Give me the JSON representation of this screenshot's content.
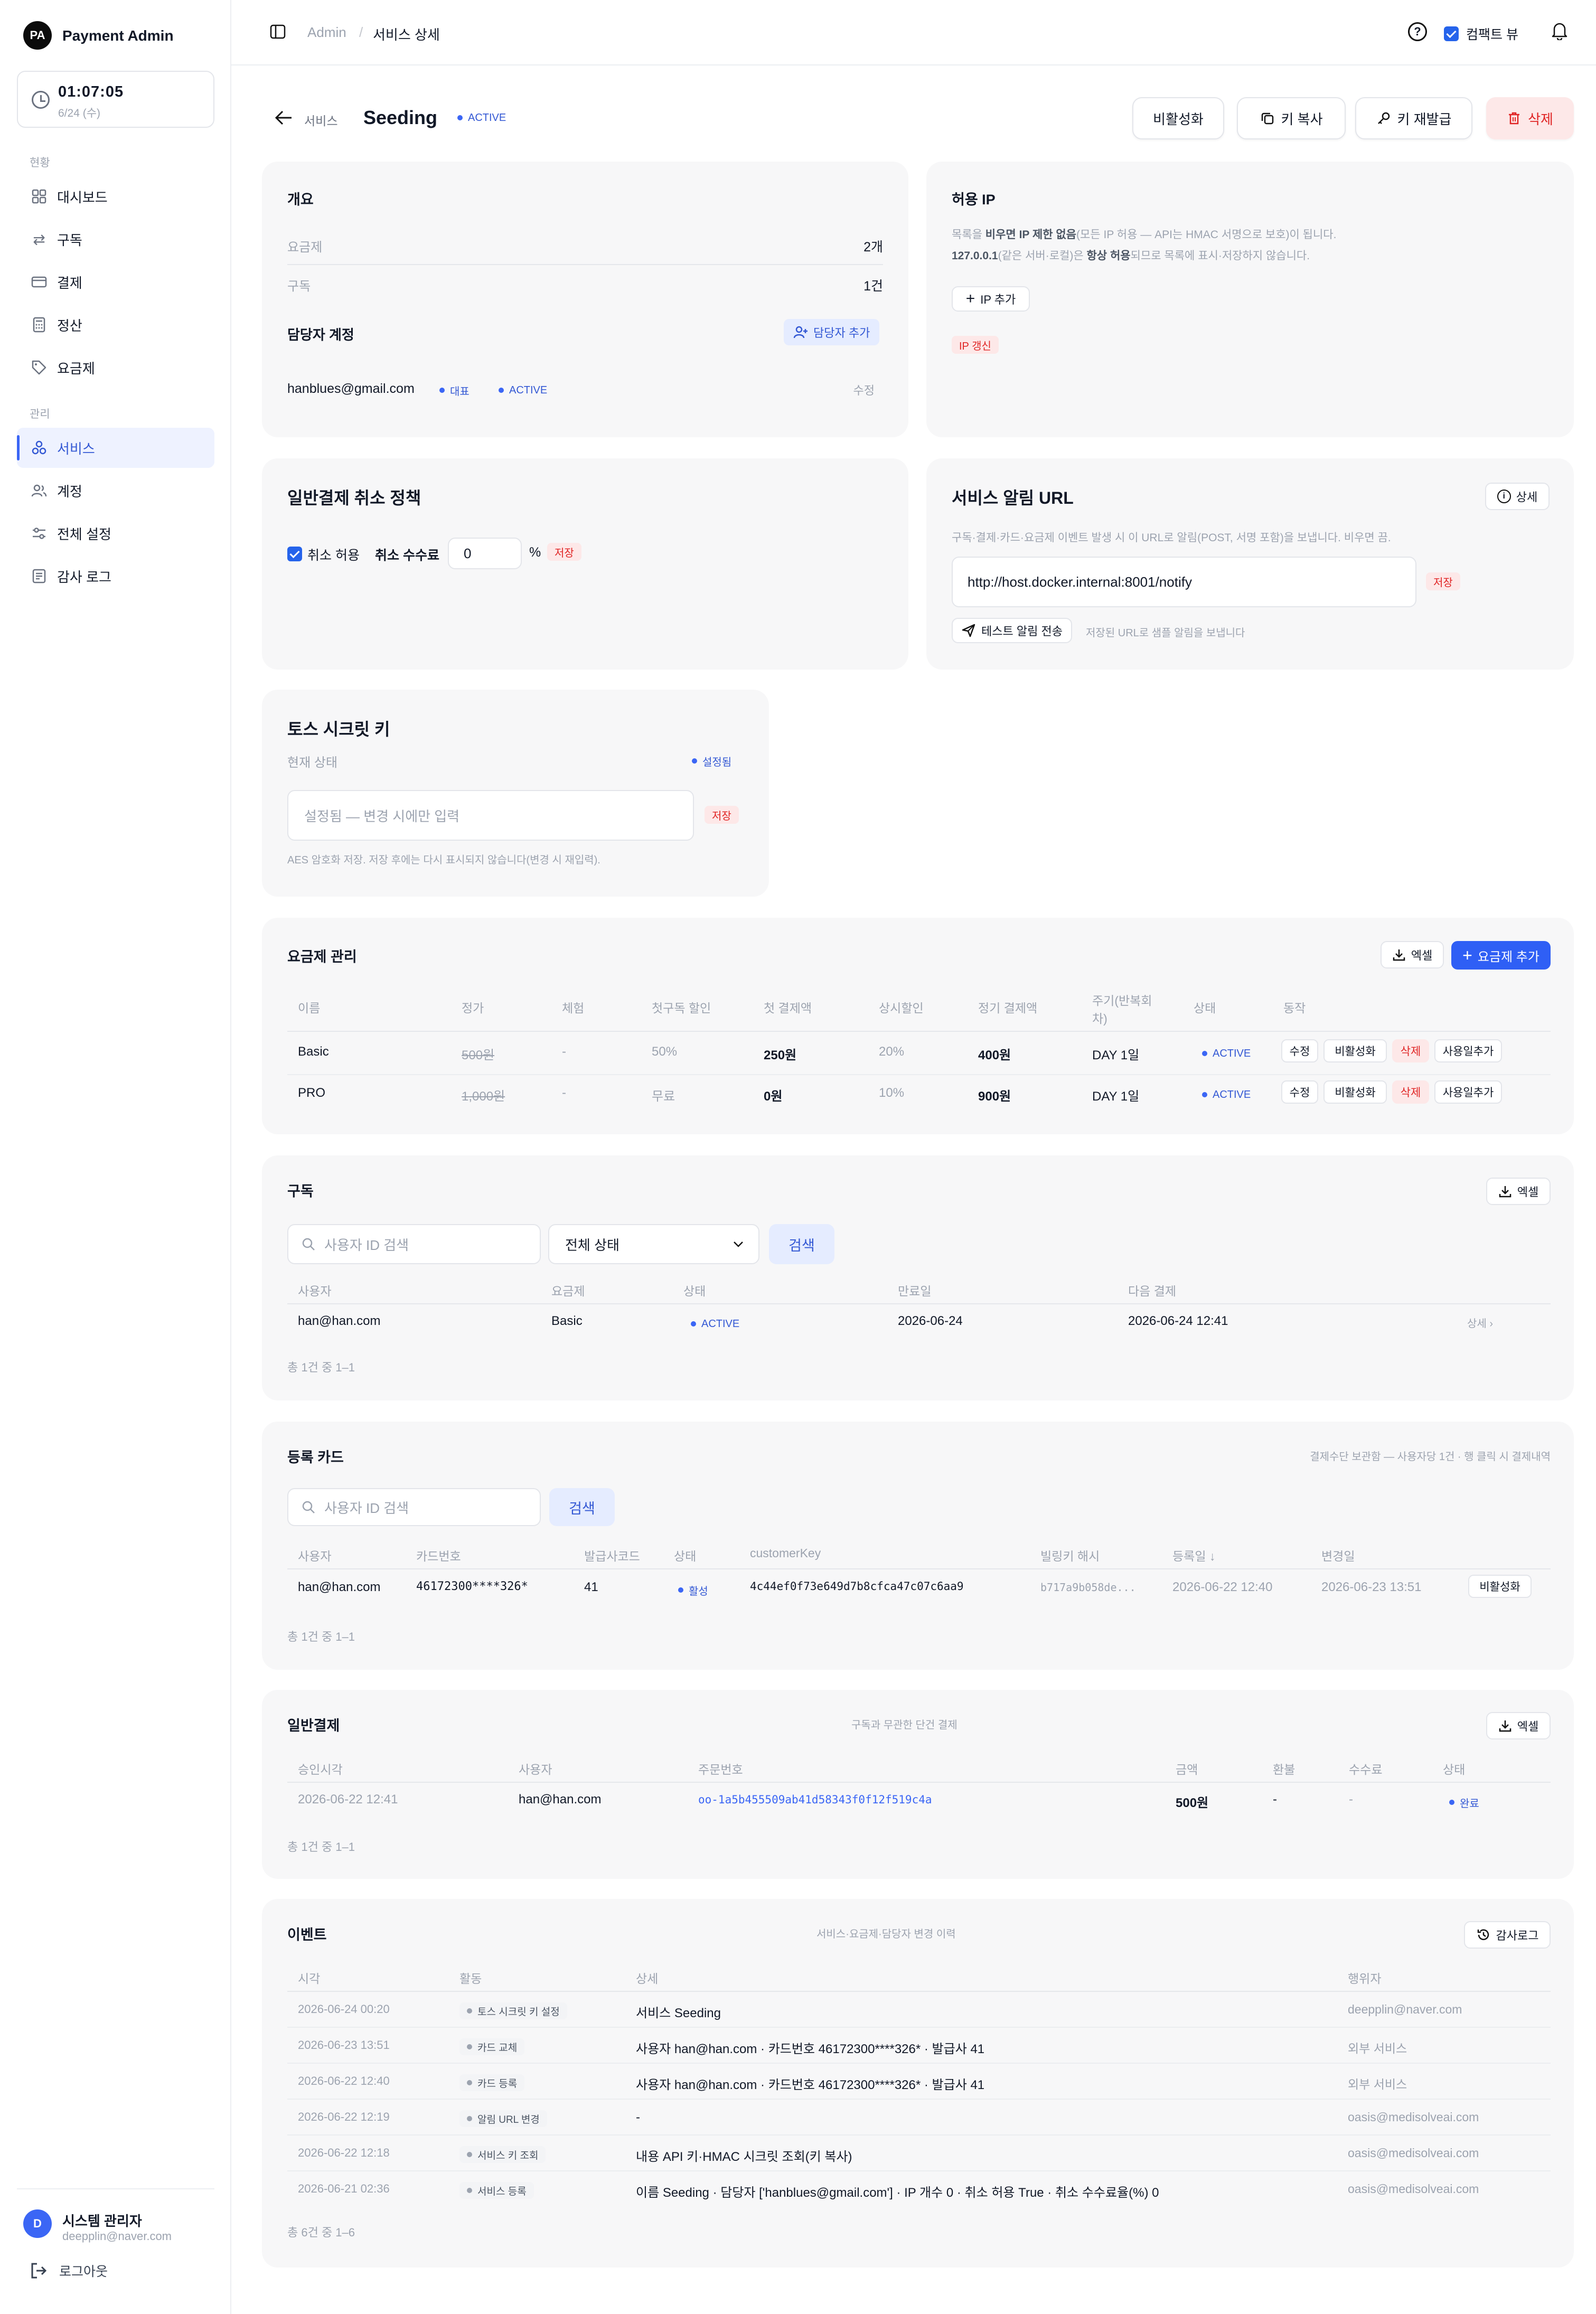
{
  "sidebar": {
    "logo": "PA",
    "brand": "Payment Admin",
    "clock_time": "01:07:05",
    "clock_date": "6/24 (수)",
    "section_status": "현황",
    "section_manage": "관리",
    "items": [
      {
        "label": "대시보드",
        "icon": "dashboard-icon"
      },
      {
        "label": "구독",
        "icon": "repeat-icon"
      },
      {
        "label": "결제",
        "icon": "card-icon"
      },
      {
        "label": "정산",
        "icon": "calculator-icon"
      },
      {
        "label": "요금제",
        "icon": "tag-icon"
      },
      {
        "label": "서비스",
        "icon": "services-icon"
      },
      {
        "label": "계정",
        "icon": "users-icon"
      },
      {
        "label": "전체 설정",
        "icon": "settings-icon"
      },
      {
        "label": "감사 로그",
        "icon": "log-icon"
      }
    ],
    "user_initial": "D",
    "user_name": "시스템 관리자",
    "user_email": "deepplin@naver.com",
    "logout": "로그아웃"
  },
  "topbar": {
    "breadcrumb_root": "Admin",
    "breadcrumb_sep": "/",
    "breadcrumb_current": "서비스 상세",
    "compact_label": "컴팩트 뷰"
  },
  "header": {
    "back_label": "서비스",
    "title": "Seeding",
    "status": "ACTIVE",
    "btn_deactivate": "비활성화",
    "btn_copy_key": "키 복사",
    "btn_reissue_key": "키 재발급",
    "btn_delete": "삭제"
  },
  "overview": {
    "title": "개요",
    "plans_label": "요금제",
    "plans_value": "2개",
    "subs_label": "구독",
    "subs_value": "1건",
    "managers_title": "담당자 계정",
    "add_manager": "담당자 추가",
    "manager_email": "hanblues@gmail.com",
    "manager_badge_rep": "대표",
    "manager_badge_status": "ACTIVE",
    "manager_edit": "수정"
  },
  "allowed_ip": {
    "title": "허용 IP",
    "desc1_a": "목록을 ",
    "desc1_b": "비우면 IP 제한 없음",
    "desc1_c": "(모든 IP 허용 — API는 HMAC 서명으로 보호)이 됩니다.",
    "desc2_a": "127.0.0.1",
    "desc2_b": "(같은 서버·로컬)은 ",
    "desc2_c": "항상 허용",
    "desc2_d": "되므로 목록에 표시·저장하지 않습니다.",
    "add_ip": "IP 추가",
    "refresh_ip": "IP 갱신"
  },
  "cancel_policy": {
    "title": "일반결제 취소 정책",
    "allow_cancel": "취소 허용",
    "fee_label": "취소 수수료",
    "fee_value": "0",
    "fee_unit": "%",
    "save": "저장"
  },
  "notify_url": {
    "title": "서비스 알림 URL",
    "detail": "상세",
    "desc": "구독·결제·카드·요금제 이벤트 발생 시 이 URL로 알림(POST, 서명 포함)을 보냅니다. 비우면 끔.",
    "url": "http://host.docker.internal:8001/notify",
    "save": "저장",
    "test_send": "테스트 알림 전송",
    "test_hint": "저장된 URL로 샘플 알림을 보냅니다"
  },
  "toss_key": {
    "title": "토스 시크릿 키",
    "status_label": "현재 상태",
    "status_value": "설정됨",
    "placeholder": "설정됨 — 변경 시에만 입력",
    "save": "저장",
    "hint": "AES 암호화 저장. 저장 후에는 다시 표시되지 않습니다(변경 시 재입력)."
  },
  "plans": {
    "title": "요금제 관리",
    "excel": "엑셀",
    "add": "요금제 추가",
    "headers": [
      "이름",
      "정가",
      "체험",
      "첫구독 할인",
      "첫 결제액",
      "상시할인",
      "정기 결제액",
      "주기(반복회차)",
      "상태",
      "동작"
    ],
    "rows": [
      {
        "name": "Basic",
        "list_price": "500원",
        "trial": "-",
        "first_discount": "50%",
        "first_amount": "250원",
        "always_discount": "20%",
        "regular_amount": "400원",
        "cycle": "DAY 1일",
        "status": "ACTIVE"
      },
      {
        "name": "PRO",
        "list_price": "1,000원",
        "trial": "-",
        "first_discount": "무료",
        "first_amount": "0원",
        "always_discount": "10%",
        "regular_amount": "900원",
        "cycle": "DAY 1일",
        "status": "ACTIVE"
      }
    ],
    "actions": {
      "edit": "수정",
      "deactivate": "비활성화",
      "delete": "삭제",
      "add_days": "사용일추가"
    }
  },
  "subscriptions": {
    "title": "구독",
    "excel": "엑셀",
    "search_placeholder": "사용자 ID 검색",
    "status_select": "전체 상태",
    "search_btn": "검색",
    "headers": [
      "사용자",
      "요금제",
      "상태",
      "만료일",
      "다음 결제"
    ],
    "rows": [
      {
        "user": "han@han.com",
        "plan": "Basic",
        "status": "ACTIVE",
        "expires": "2026-06-24",
        "next": "2026-06-24 12:41",
        "detail": "상세 ›"
      }
    ],
    "footer": "총 1건 중 1–1"
  },
  "cards": {
    "title": "등록 카드",
    "note": "결제수단 보관함 — 사용자당 1건 · 행 클릭 시 결제내역",
    "search_placeholder": "사용자 ID 검색",
    "search_btn": "검색",
    "headers": [
      "사용자",
      "카드번호",
      "발급사코드",
      "상태",
      "customerKey",
      "빌링키 해시",
      "등록일 ↓",
      "변경일"
    ],
    "rows": [
      {
        "user": "han@han.com",
        "card_no": "46172300****326*",
        "issuer": "41",
        "status": "활성",
        "customer_key": "4c44ef0f73e649d7b8cfca47c07c6aa9",
        "billing_hash": "b717a9b058de...",
        "registered": "2026-06-22 12:40",
        "changed": "2026-06-23 13:51",
        "action": "비활성화"
      }
    ],
    "footer": "총 1건 중 1–1"
  },
  "payments": {
    "title": "일반결제",
    "note": "구독과 무관한 단건 결제",
    "excel": "엑셀",
    "headers": [
      "승인시각",
      "사용자",
      "주문번호",
      "금액",
      "환불",
      "수수료",
      "상태"
    ],
    "rows": [
      {
        "approved": "2026-06-22 12:41",
        "user": "han@han.com",
        "order_no": "oo-1a5b455509ab41d58343f0f12f519c4a",
        "amount": "500원",
        "refund": "-",
        "fee": "-",
        "status": "완료"
      }
    ],
    "footer": "총 1건 중 1–1"
  },
  "events": {
    "title": "이벤트",
    "note": "서비스·요금제·담당자 변경 이력",
    "audit_btn": "감사로그",
    "headers": [
      "시각",
      "활동",
      "상세",
      "행위자"
    ],
    "rows": [
      {
        "time": "2026-06-24 00:20",
        "activity": "토스 시크릿 키 설정",
        "detail": "서비스 Seeding",
        "actor": "deepplin@naver.com"
      },
      {
        "time": "2026-06-23 13:51",
        "activity": "카드 교체",
        "detail": "사용자 han@han.com · 카드번호 46172300****326* · 발급사 41",
        "actor": "외부 서비스"
      },
      {
        "time": "2026-06-22 12:40",
        "activity": "카드 등록",
        "detail": "사용자 han@han.com · 카드번호 46172300****326* · 발급사 41",
        "actor": "외부 서비스"
      },
      {
        "time": "2026-06-22 12:19",
        "activity": "알림 URL 변경",
        "detail": "-",
        "actor": "oasis@medisolveai.com"
      },
      {
        "time": "2026-06-22 12:18",
        "activity": "서비스 키 조회",
        "detail": "내용 API 키·HMAC 시크릿 조회(키 복사)",
        "actor": "oasis@medisolveai.com"
      },
      {
        "time": "2026-06-21 02:36",
        "activity": "서비스 등록",
        "detail": "이름 Seeding · 담당자 ['hanblues@gmail.com'] · IP 개수 0 · 취소 허용 True · 취소 수수료율(%) 0",
        "actor": "oasis@medisolveai.com"
      }
    ],
    "footer": "총 6건 중 1–6"
  },
  "colors": {
    "accent": "#2f5ff5",
    "danger": "#e02424",
    "card_bg": "#f7f7f8"
  }
}
